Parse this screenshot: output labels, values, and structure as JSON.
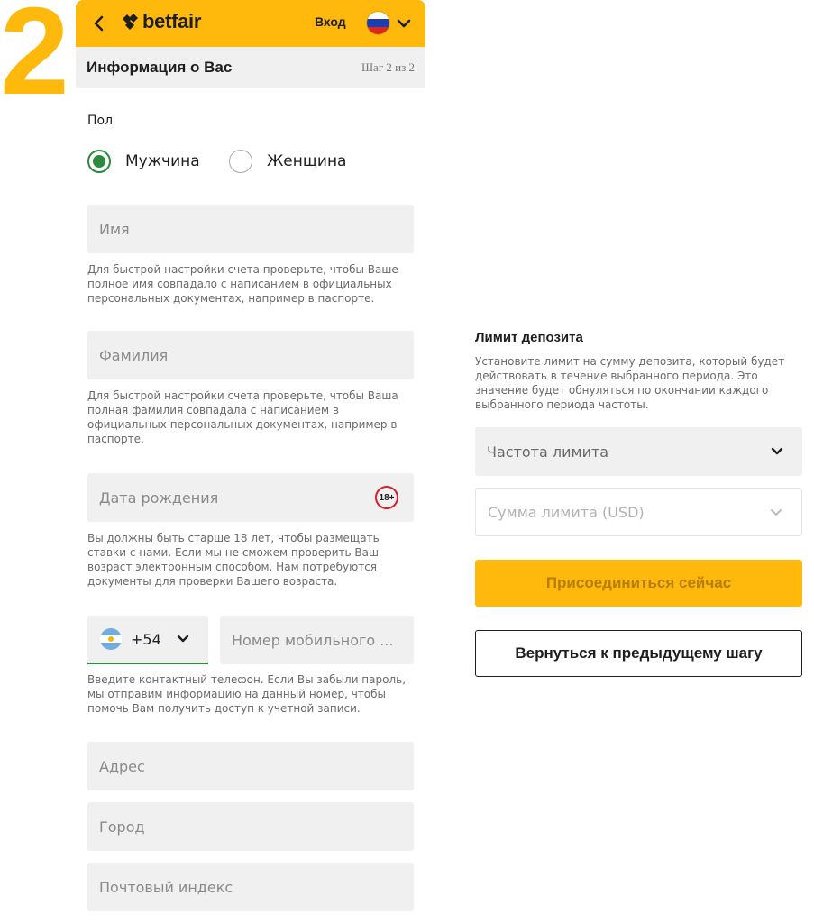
{
  "step_number": "2",
  "header": {
    "logo": "betfair",
    "login": "Вход",
    "language_flag": "russia-flag"
  },
  "subheader": {
    "title": "Информация о Вас",
    "step": "Шаг 2 из 2"
  },
  "gender": {
    "label": "Пол",
    "options": [
      {
        "label": "Мужчина",
        "selected": true
      },
      {
        "label": "Женщина",
        "selected": false
      }
    ]
  },
  "first_name": {
    "placeholder": "Имя",
    "hint": "Для быстрой настройки счета проверьте, чтобы Ваше полное имя совпадало с написанием в официальных персональных документах, например в паспорте."
  },
  "last_name": {
    "placeholder": "Фамилия",
    "hint": "Для быстрой настройки счета проверьте, чтобы Ваша полная фамилия совпадала с написанием в официальных персональных документах, например в паспорте."
  },
  "birth_date": {
    "placeholder": "Дата рождения",
    "badge": "18+",
    "hint": "Вы должны быть старше 18 лет, чтобы размещать ставки с нами. Если мы не сможем проверить Ваш возраст электронным способом. Нам потребуются документы для проверки Вашего возраста."
  },
  "phone": {
    "country_code": "+54",
    "country_flag": "argentina-flag",
    "placeholder": "Номер мобильного ...",
    "hint": "Введите контактный телефон. Если Вы забыли пароль, мы отправим информацию на данный номер, чтобы помочь Вам получить доступ к учетной записи."
  },
  "address": {
    "placeholder": "Адрес"
  },
  "city": {
    "placeholder": "Город"
  },
  "postcode": {
    "placeholder": "Почтовый индекс"
  },
  "deposit_limit": {
    "title": "Лимит депозита",
    "description": "Установите лимит на сумму депозита, который будет действовать в течение выбранного периода.  Это значение будет обнуляться по окончании каждого выбранного периода частоты.",
    "frequency_placeholder": "Частота лимита",
    "amount_placeholder": "Сумма лимита (USD)"
  },
  "buttons": {
    "join": "Присоединиться сейчас",
    "back": "Вернуться к предыдущему шагу"
  },
  "colors": {
    "brand": "#ffb80c",
    "selected_green": "#2c8b3d",
    "age_badge_red": "#d3212c",
    "field_bg": "#f0f0f0"
  }
}
